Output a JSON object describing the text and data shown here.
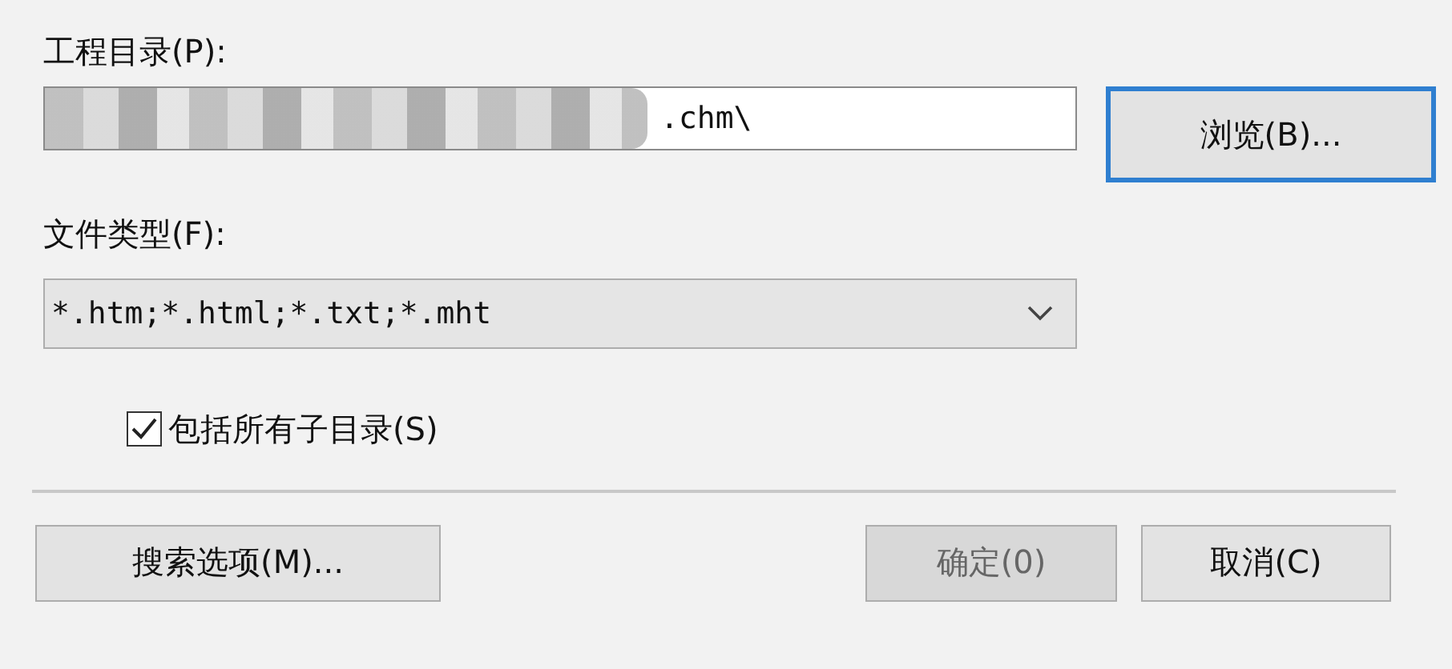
{
  "project_dir": {
    "label": "工程目录(P):",
    "value": ".chm\\",
    "redacted": true
  },
  "browse_button": {
    "label": "浏览(B)...",
    "focused": true
  },
  "file_type": {
    "label": "文件类型(F):",
    "value": "*.htm;*.html;*.txt;*.mht"
  },
  "include_subdirs": {
    "label": "包括所有子目录(S)",
    "checked": true
  },
  "buttons": [
    {
      "label": "搜索选项(M)...",
      "disabled": false
    },
    {
      "label": "确定(0)",
      "disabled": true
    },
    {
      "label": "取消(C)",
      "disabled": false
    }
  ]
}
